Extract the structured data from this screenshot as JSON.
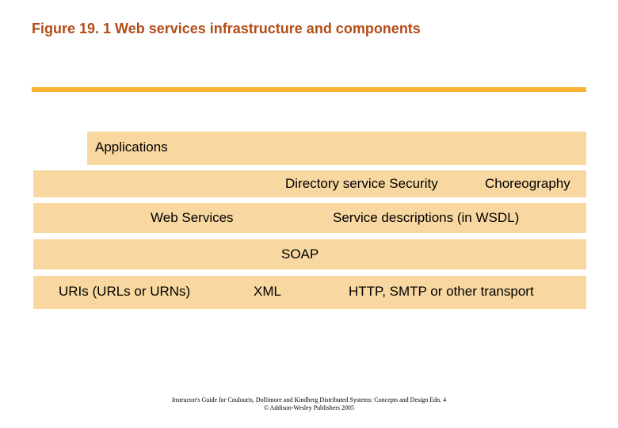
{
  "title": "Figure 19. 1 Web services infrastructure and components",
  "labels": {
    "applications": "Applications",
    "directory_security": "Directory service Security",
    "choreography": "Choreography",
    "web_services": "Web Services",
    "service_desc": "Service descriptions (in WSDL)",
    "soap": "SOAP",
    "uris": "URIs (URLs or URNs)",
    "xml": "XML",
    "http": "HTTP, SMTP or other transport"
  },
  "footer": {
    "line1": "Instructor's Guide for  Coulouris, Dollimore and Kindberg   Distributed Systems: Concepts and Design   Edn. 4",
    "line2": "©  Addison-Wesley Publishers 2005"
  },
  "colors": {
    "title": "#b34d17",
    "band": "#f8d7a0",
    "rule": "#f9b233"
  }
}
